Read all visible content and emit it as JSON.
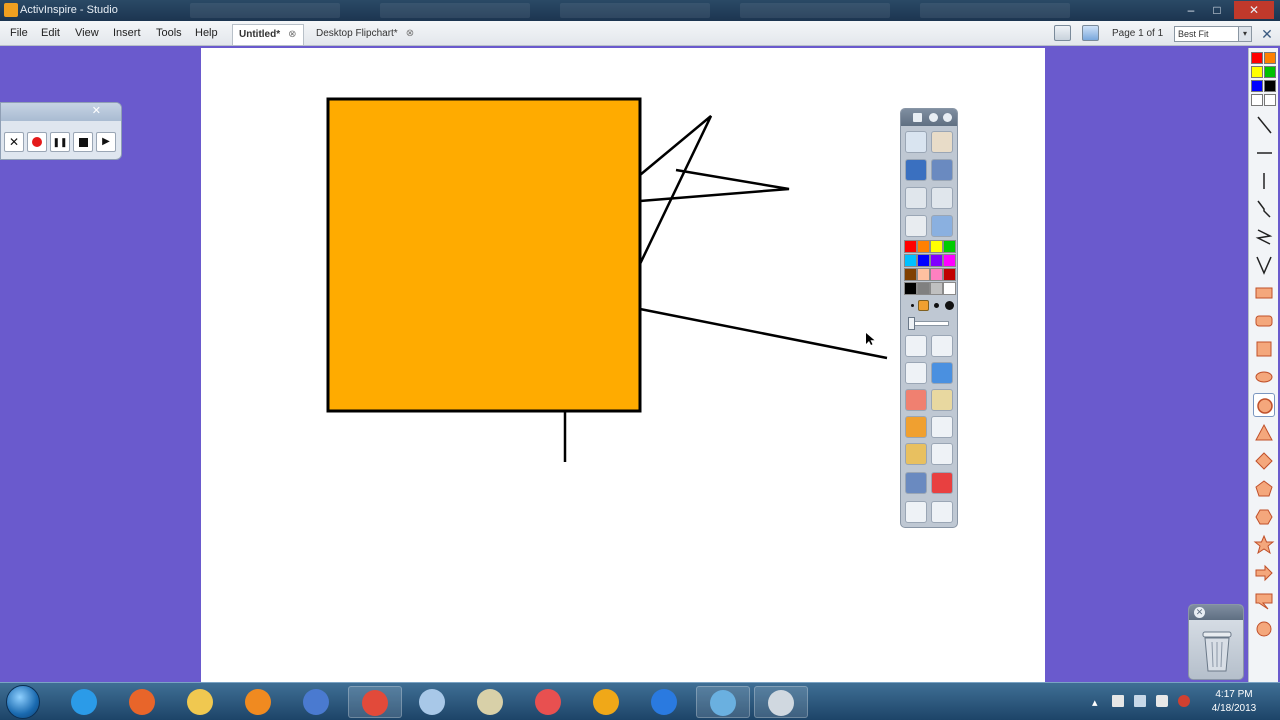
{
  "window": {
    "title": "ActivInspire - Studio",
    "controls": {
      "minimize": "–",
      "maximize": "□",
      "close": "✕"
    }
  },
  "menubar": {
    "items": [
      "File",
      "Edit",
      "View",
      "Insert",
      "Tools",
      "Help"
    ],
    "tabs": [
      {
        "label": "Untitled*",
        "close": "⊗",
        "active": true
      },
      {
        "label": "Desktop Flipchart*",
        "close": "⊗",
        "active": false
      }
    ],
    "page_indicator": "Page 1 of 1",
    "zoom": "Best Fit",
    "zoom_arrow": "▾",
    "restore": "✕"
  },
  "recorder": {
    "close": "✕",
    "buttons": [
      {
        "name": "cancel",
        "glyph": "✕"
      },
      {
        "name": "record",
        "glyph": ""
      },
      {
        "name": "pause",
        "glyph": "❚❚"
      },
      {
        "name": "stop",
        "glyph": ""
      },
      {
        "name": "play",
        "glyph": "▶"
      }
    ]
  },
  "canvas": {
    "shape_fill": "#ffab00",
    "stroke": "#000000"
  },
  "toolbox": {
    "palette": [
      "#ff0000",
      "#ff8000",
      "#ffff00",
      "#00cc00",
      "#00c0ff",
      "#0000ff",
      "#8000ff",
      "#ff00ff",
      "#804000",
      "#ffc0a0",
      "#ff80c0",
      "#c00000",
      "#000000",
      "#808080",
      "#c0c0c0",
      "#ffffff"
    ],
    "tools": [
      "main-menu-icon",
      "profile-icon",
      "page-browser-icon",
      "resource-browser-icon",
      "previous-page-icon",
      "next-page-icon",
      "page-reset-icon",
      "desktop-annotate-icon",
      "select-icon",
      "magic-ink-icon",
      "pen-icon",
      "highlighter-icon",
      "eraser-icon",
      "fill-icon",
      "shape-icon",
      "connector-icon",
      "tools-icon",
      "text-icon",
      "spotlight-icon",
      "clear-icon",
      "undo-icon",
      "redo-icon"
    ]
  },
  "right_palette": {
    "colors": [
      "#ff0000",
      "#ff8000",
      "#ffff00",
      "#00c000",
      "#0000ff",
      "#000000",
      "#ffffff",
      "#ffffff"
    ],
    "shapes": [
      "line-diagonal",
      "line-horizontal",
      "line-vertical",
      "line-zigzag",
      "line-z",
      "line-v",
      "rectangle",
      "rounded-rectangle",
      "square",
      "ellipse",
      "circle",
      "triangle",
      "diamond",
      "pentagon",
      "hexagon",
      "star",
      "arrow",
      "callout",
      "circle-small"
    ],
    "selected_shape": "circle",
    "shape_fill": "#f4a77c",
    "shape_stroke": "#c0502a"
  },
  "trash": {
    "close": "✕"
  },
  "taskbar": {
    "apps": [
      {
        "name": "internet-explorer",
        "color": "#2b9be8",
        "open": false
      },
      {
        "name": "firefox",
        "color": "#e8652a",
        "open": false
      },
      {
        "name": "file-explorer",
        "color": "#f0c850",
        "open": false
      },
      {
        "name": "media-player",
        "color": "#f08a20",
        "open": false
      },
      {
        "name": "itunes",
        "color": "#4a7ad0",
        "open": false
      },
      {
        "name": "chrome",
        "color": "#e24a3a",
        "open": true
      },
      {
        "name": "notepad",
        "color": "#a8c8e8",
        "open": false
      },
      {
        "name": "paint",
        "color": "#d8d0a8",
        "open": false
      },
      {
        "name": "snipping-tool",
        "color": "#e85050",
        "open": false
      },
      {
        "name": "vlc-v",
        "color": "#f0a818",
        "open": false
      },
      {
        "name": "downloader",
        "color": "#2a7ae0",
        "open": false
      },
      {
        "name": "window-manager",
        "color": "#6ab0e0",
        "open": true
      },
      {
        "name": "activinspire",
        "color": "#d0d8e0",
        "open": true
      }
    ],
    "tray": "▴",
    "time": "4:17 PM",
    "date": "4/18/2013"
  }
}
